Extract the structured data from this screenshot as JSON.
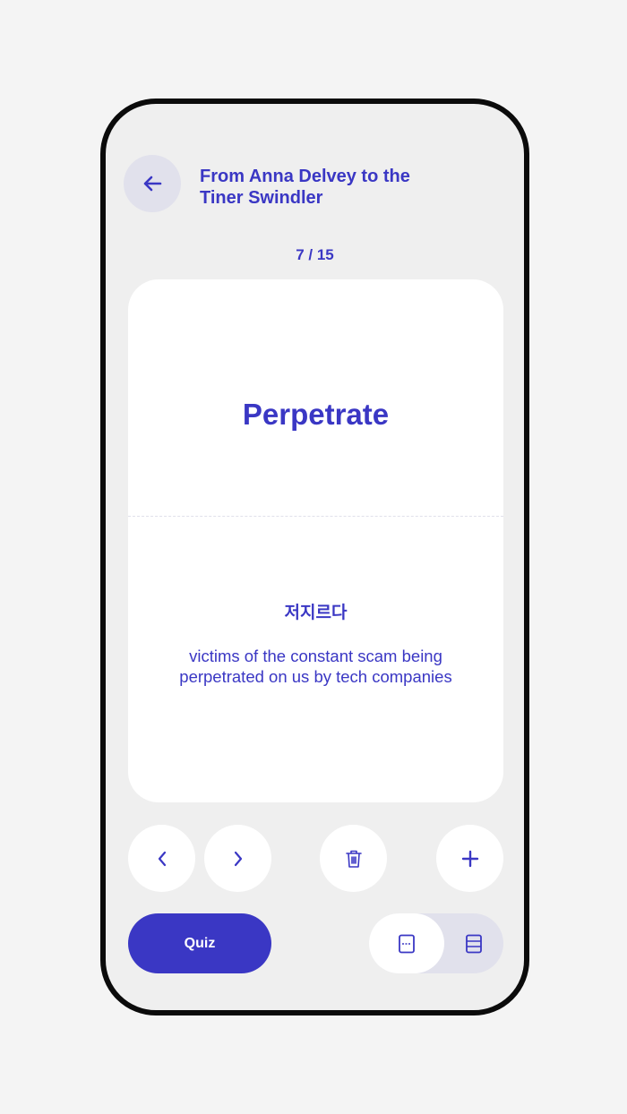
{
  "header": {
    "back_icon": "arrow-left-icon",
    "title": "From Anna Delvey to the Tiner Swindler"
  },
  "progress": {
    "current": 7,
    "total": 15,
    "label": "7 / 15"
  },
  "card": {
    "word": "Perpetrate",
    "translation": "저지르다",
    "example": "victims of the constant scam being perpetrated on us by tech companies"
  },
  "controls": {
    "prev_icon": "chevron-left-icon",
    "next_icon": "chevron-right-icon",
    "delete_icon": "trash-icon",
    "add_icon": "plus-icon"
  },
  "footer": {
    "quiz_label": "Quiz",
    "view_modes": [
      {
        "icon": "card-split-view-icon",
        "selected": true
      },
      {
        "icon": "list-view-icon",
        "selected": false
      }
    ]
  },
  "colors": {
    "accent": "#3a37c4",
    "background": "#efefef",
    "card": "#ffffff",
    "muted": "#e1e1ec"
  }
}
